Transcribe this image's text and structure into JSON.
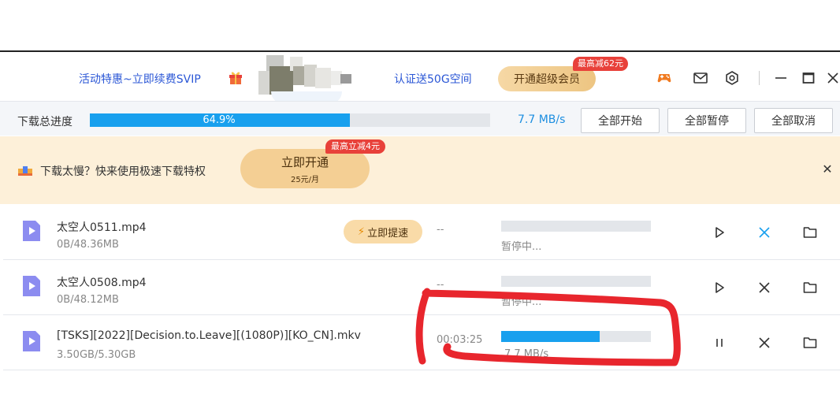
{
  "header": {
    "promo_left": "活动特惠~立即续费SVIP",
    "promo_right": "认证送50G空间",
    "svip_button": "开通超级会员",
    "svip_tag": "最高减62元",
    "icons": [
      "gamepad-icon",
      "mail-icon",
      "settings-icon",
      "minimize-icon",
      "maximize-icon",
      "close-icon"
    ]
  },
  "total": {
    "label": "下载总进度",
    "percent_text": "64.9%",
    "percent": 64.9,
    "speed": "7.7 MB/s",
    "start_all": "全部开始",
    "pause_all": "全部暂停",
    "cancel_all": "全部取消"
  },
  "banner": {
    "text": "下载太慢？快来使用极速下载特权",
    "open_label": "立即开通",
    "open_price": "25元/月",
    "open_tag": "最高立减4元"
  },
  "downloads": [
    {
      "name": "太空人0511.mp4",
      "size": "0B/48.36MB",
      "boost": "立即提速",
      "eta": "--",
      "progress": 0,
      "status": "暂停中..."
    },
    {
      "name": "太空人0508.mp4",
      "size": "0B/48.12MB",
      "eta": "--",
      "progress": 0,
      "status": "暂停中..."
    },
    {
      "name": "[TSKS][2022][Decision.to.Leave][(1080P)][KO_CN].mkv",
      "size": "3.50GB/5.30GB",
      "eta": "00:03:25",
      "progress": 66,
      "status": "7.7 MB/s"
    }
  ],
  "colors": {
    "accent": "#18a0ee",
    "promo_text": "#2b57d6",
    "gold": "#f4cf94",
    "tag_red": "#e8413a",
    "annotation_red": "#e8262d"
  }
}
